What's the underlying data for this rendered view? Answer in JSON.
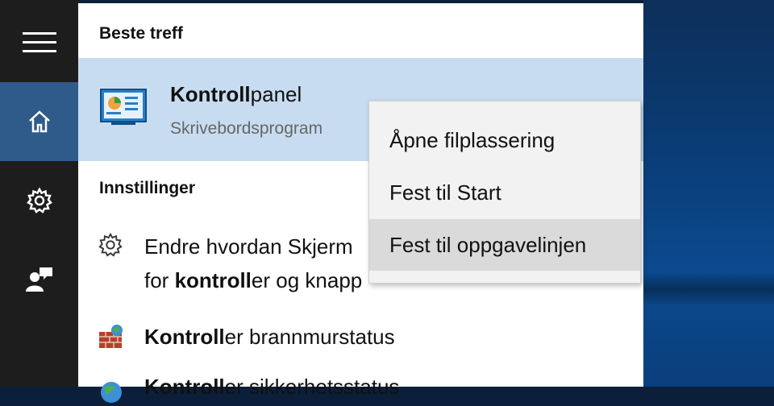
{
  "rail": {
    "items": [
      {
        "icon": "hamburger-menu-icon"
      },
      {
        "icon": "home-icon",
        "active": true
      },
      {
        "icon": "gear-icon"
      },
      {
        "icon": "user-feedback-icon"
      }
    ]
  },
  "panel": {
    "best_match_heading": "Beste treff",
    "best_match": {
      "title_bold": "Kontroll",
      "title_rest": "panel",
      "subtitle": "Skrivebordsprogram",
      "icon": "control-panel-icon"
    },
    "settings_heading": "Innstillinger",
    "results": [
      {
        "icon": "gear-icon",
        "line1": "Endre hvordan Skjerm",
        "line2_pre": "for ",
        "line2_bold": "kontroll",
        "line2_post": "er og knapp"
      },
      {
        "icon": "firewall-icon",
        "text_bold": "Kontroll",
        "text_rest": "er brannmurstatus"
      },
      {
        "icon": "globe-icon",
        "text_bold": "Kontroll",
        "text_rest": "er sikkerhetsstatus"
      }
    ]
  },
  "context_menu": {
    "items": [
      {
        "label": "Åpne filplassering"
      },
      {
        "label": "Fest til Start"
      },
      {
        "label": "Fest til oppgavelinjen",
        "hovered": true
      }
    ]
  },
  "colors": {
    "rail_bg": "#1d1d1d",
    "rail_active": "#2e5b8a",
    "best_match_bg": "#c7dcf0",
    "context_menu_bg": "#f2f2f2",
    "context_hover": "#dadada"
  }
}
